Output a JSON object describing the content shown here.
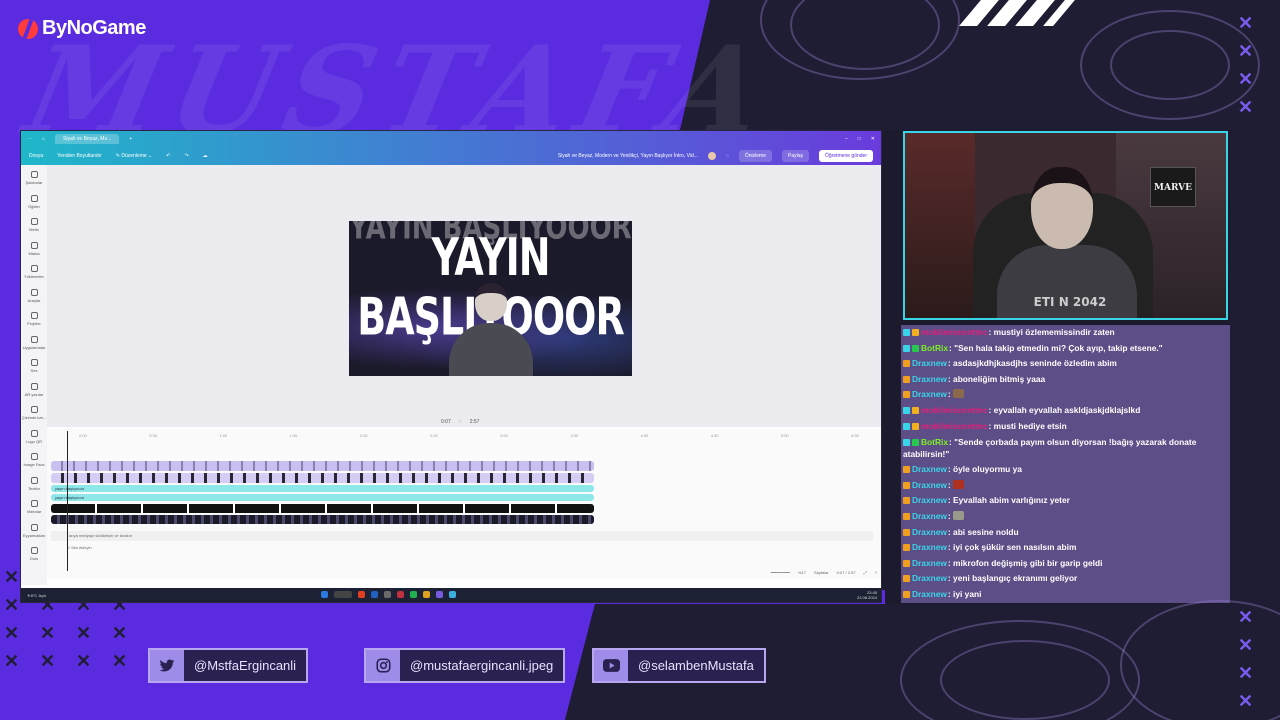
{
  "brand": {
    "logo_text": "ByNoGame",
    "watermark": "MUSTAFA"
  },
  "colors": {
    "purple": "#5b2be0",
    "dark": "#1f1d33",
    "cyan": "#3ad4e8"
  },
  "canva": {
    "tab_title": "Siyah ve Beyaz, Mo...",
    "menu": {
      "file": "Dosya",
      "resize": "Yeniden Boyutlandır",
      "edit": "Düzenleme"
    },
    "doc_title": "Siyah ve Beyaz, Modern ve Yenilikçi, Yayın Başlıyor İntro, Vid...",
    "preview_btn": "Önizleme",
    "share_btn": "Paylaş",
    "teach_btn": "Öğretmene gönder",
    "sidebar": [
      "Şablonlar",
      "Öğeler",
      "Metin",
      "Marka",
      "Yüklemeler",
      "Araçlar",
      "Projeler",
      "Uygulamalar",
      "Ses",
      "AR yazılar",
      "Çizimde kar...",
      "Logo QR",
      "Image Facs",
      "Textfor",
      "Videolar",
      "Eyyamuktan",
      "Dolu"
    ],
    "design": {
      "ghost_text": "YAYIN BAŞLIYOOOR",
      "title": "YAYIN BAŞLIYOOOR"
    },
    "playback": {
      "current": "0:07",
      "total": "2:57"
    },
    "ruler": [
      "0:00",
      "0:30",
      "1:00",
      "1:30",
      "2:00",
      "2:30",
      "3:00",
      "3:30",
      "4:00",
      "4:30",
      "5:00",
      "5:30"
    ],
    "tracks": {
      "text1": "yayın başlıyooor",
      "text2": "yayın başlıyooor",
      "audio": "arıya medyayı sürükleyin ve bırakın",
      "add_label": "Ses ekleyin"
    },
    "footer": {
      "zoom": "%17",
      "pages": "Sayfalar",
      "time": "0:07 / 2:57"
    }
  },
  "taskbar": {
    "weather_temp": "8°C",
    "weather_desc": "Açık",
    "search": "Ara",
    "time": "22:45",
    "date": "22.08.2024"
  },
  "cam": {
    "shirt": "ETI N 2042",
    "poster": "MARVE"
  },
  "chat": [
    {
      "user": "mobilmiscenttnc",
      "text": ": mustiyi özlememissindir zaten",
      "ucolor": "#e0207a",
      "badges": [
        "#3ad4e8",
        "#f0b020"
      ]
    },
    {
      "user": "BotRix",
      "text": ": \"Sen hala takip etmedin mi? Çok ayıp, takip etsene.\"",
      "ucolor": "#7cf028",
      "badges": [
        "#3ad4e8",
        "#28c850"
      ]
    },
    {
      "user": "Draxnew",
      "text": ": asdasjkdhjkasdjhs seninde özledim abim",
      "ucolor": "#3ad4e8",
      "badges": [
        "#f0a020"
      ]
    },
    {
      "user": "Draxnew",
      "text": ": aboneliğim bitmiş yaaa",
      "ucolor": "#3ad4e8",
      "badges": [
        "#f0a020"
      ]
    },
    {
      "user": "Draxnew",
      "text": ": ",
      "ucolor": "#3ad4e8",
      "badges": [
        "#f0a020"
      ],
      "emote": "#8a6a4a"
    },
    {
      "user": "mobilmiscenttnc",
      "text": ": eyvallah eyvallah askldjaskjdklajslkd",
      "ucolor": "#e0207a",
      "badges": [
        "#3ad4e8",
        "#f0b020"
      ]
    },
    {
      "user": "mobilmiscenttnc",
      "text": ": musti hediye etsin",
      "ucolor": "#e0207a",
      "badges": [
        "#3ad4e8",
        "#f0b020"
      ]
    },
    {
      "user": "BotRix",
      "text": ": \"Sende çorbada payım olsun diyorsan !bağış yazarak donate atabilirsin!\"",
      "ucolor": "#7cf028",
      "badges": [
        "#3ad4e8",
        "#28c850"
      ],
      "wrap": true
    },
    {
      "user": "Draxnew",
      "text": ": öyle oluyormu ya",
      "ucolor": "#3ad4e8",
      "badges": [
        "#f0a020"
      ]
    },
    {
      "user": "Draxnew",
      "text": ": ",
      "ucolor": "#3ad4e8",
      "badges": [
        "#f0a020"
      ],
      "emote": "#b03020"
    },
    {
      "user": "Draxnew",
      "text": ": Eyvallah abim varlığınız yeter",
      "ucolor": "#3ad4e8",
      "badges": [
        "#f0a020"
      ]
    },
    {
      "user": "Draxnew",
      "text": ": ",
      "ucolor": "#3ad4e8",
      "badges": [
        "#f0a020"
      ],
      "emote": "#9a9a8a"
    },
    {
      "user": "Draxnew",
      "text": ": abi sesine noldu",
      "ucolor": "#3ad4e8",
      "badges": [
        "#f0a020"
      ]
    },
    {
      "user": "Draxnew",
      "text": ": iyi çok şükür sen nasılsın abim",
      "ucolor": "#3ad4e8",
      "badges": [
        "#f0a020"
      ]
    },
    {
      "user": "Draxnew",
      "text": ": mikrofon değişmiş gibi bir garip geldi",
      "ucolor": "#3ad4e8",
      "badges": [
        "#f0a020"
      ]
    },
    {
      "user": "Draxnew",
      "text": ": yeni başlangıç ekranımı geliyor",
      "ucolor": "#3ad4e8",
      "badges": [
        "#f0a020"
      ]
    },
    {
      "user": "Draxnew",
      "text": ": iyi yani",
      "ucolor": "#3ad4e8",
      "badges": [
        "#f0a020"
      ]
    }
  ],
  "socials": {
    "twitter": {
      "handle": "@MstfaErgincanli",
      "icon": "twitter-icon"
    },
    "instagram": {
      "handle": "@mustafaergincanli.jpeg",
      "icon": "instagram-icon"
    },
    "youtube": {
      "handle": "@selambenMustafa",
      "icon": "youtube-icon"
    }
  }
}
